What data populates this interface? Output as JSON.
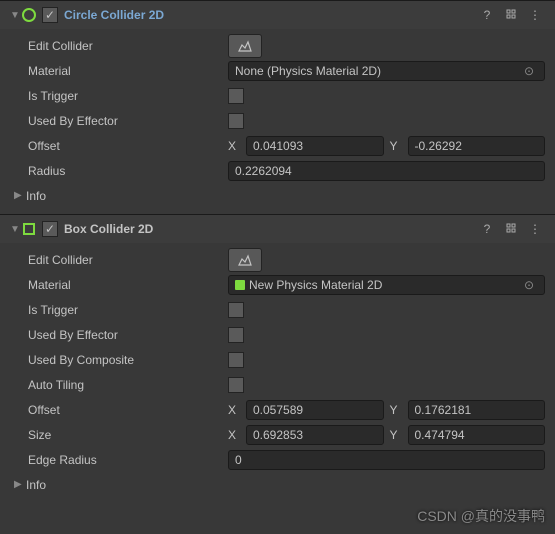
{
  "collider1": {
    "title": "Circle Collider 2D",
    "editCollider": "Edit Collider",
    "materialLabel": "Material",
    "materialValue": "None (Physics Material 2D)",
    "isTrigger": "Is Trigger",
    "usedByEffector": "Used By Effector",
    "offsetLabel": "Offset",
    "offsetX": "0.041093",
    "offsetY": "-0.26292",
    "radiusLabel": "Radius",
    "radiusValue": "0.2262094",
    "info": "Info"
  },
  "collider2": {
    "title": "Box Collider 2D",
    "editCollider": "Edit Collider",
    "materialLabel": "Material",
    "materialValue": "New Physics Material 2D",
    "isTrigger": "Is Trigger",
    "usedByEffector": "Used By Effector",
    "usedByComposite": "Used By Composite",
    "autoTiling": "Auto Tiling",
    "offsetLabel": "Offset",
    "offsetX": "0.057589",
    "offsetY": "0.1762181",
    "sizeLabel": "Size",
    "sizeX": "0.692853",
    "sizeY": "0.474794",
    "edgeRadiusLabel": "Edge Radius",
    "edgeRadiusValue": "0",
    "info": "Info"
  },
  "axis": {
    "x": "X",
    "y": "Y"
  },
  "watermark": "CSDN @真的没事鸭"
}
